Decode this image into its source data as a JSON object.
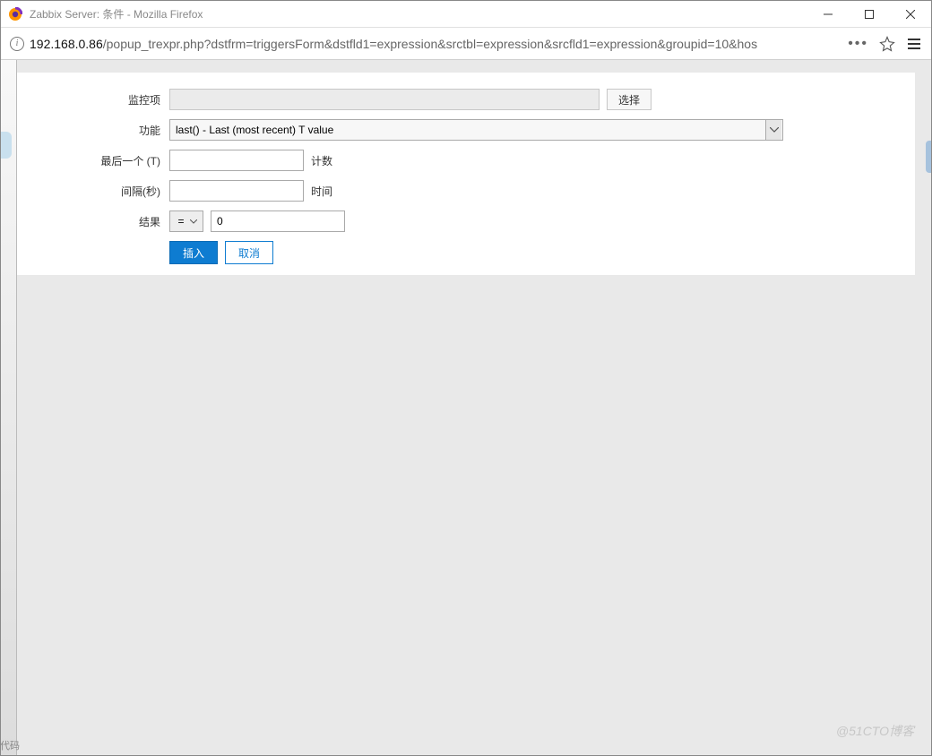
{
  "window": {
    "title": "Zabbix Server: 条件 - Mozilla Firefox"
  },
  "url": {
    "host": "192.168.0.86",
    "path": "/popup_trexpr.php?dstfrm=triggersForm&dstfld1=expression&srctbl=expression&srcfld1=expression&groupid=10&hos"
  },
  "form": {
    "monitor_item_label": "监控项",
    "select_button": "选择",
    "function_label": "功能",
    "function_value": "last() - Last (most recent) T value",
    "last_t_label": "最后一个 (T)",
    "last_t_value": "",
    "last_t_suffix": "计数",
    "interval_label": "间隔(秒)",
    "interval_value": "",
    "interval_suffix": "时间",
    "result_label": "结果",
    "result_op": "=",
    "result_value": "0",
    "insert_button": "插入",
    "cancel_button": "取消"
  },
  "watermark": "@51CTO博客",
  "bottom_left": "代码"
}
